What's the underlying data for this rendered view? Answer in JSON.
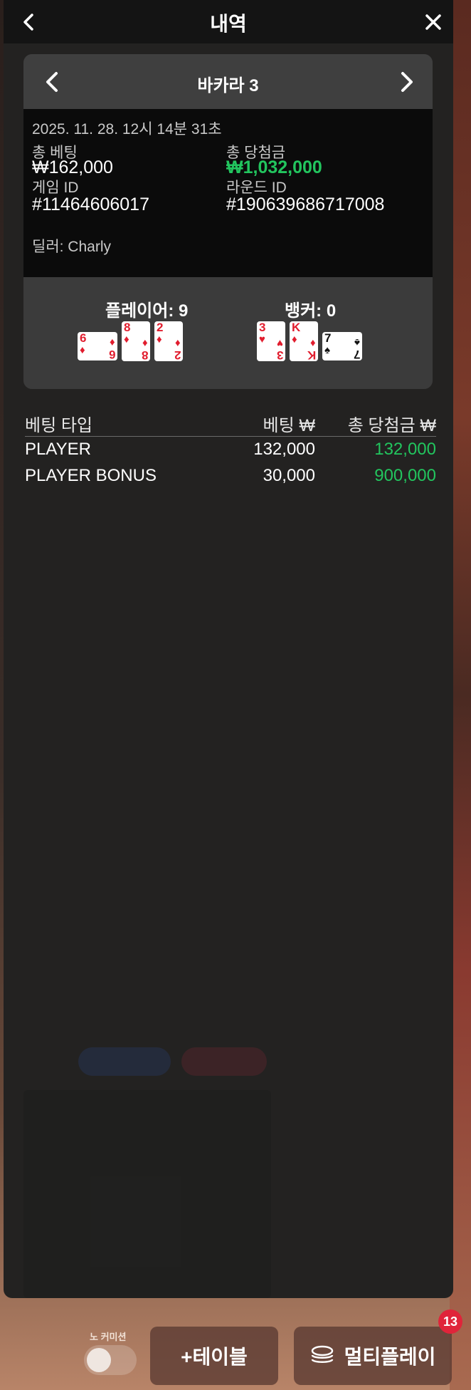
{
  "header": {
    "title": "내역"
  },
  "table_card": {
    "name": "바카라 3",
    "datetime": "2025. 11. 28. 12시 14분 31초",
    "total_bet_label": "총 베팅",
    "total_bet_value": "₩162,000",
    "total_win_label": "총 당첨금",
    "total_win_value": "₩1,032,000",
    "game_id_label": "게임 ID",
    "game_id_value": "#11464606017",
    "round_id_label": "라운드 ID",
    "round_id_value": "#190639686717008",
    "dealer": "딜러: Charly",
    "player_label": "플레이어: 9",
    "banker_label": "뱅커: 0",
    "player_cards": [
      {
        "rank": "6",
        "suit": "♦",
        "color": "#e11d2e",
        "rotated": true
      },
      {
        "rank": "8",
        "suit": "♦",
        "color": "#e11d2e",
        "rotated": false
      },
      {
        "rank": "2",
        "suit": "♦",
        "color": "#e11d2e",
        "rotated": false
      }
    ],
    "banker_cards": [
      {
        "rank": "3",
        "suit": "♥",
        "color": "#e11d2e",
        "rotated": false
      },
      {
        "rank": "K",
        "suit": "♦",
        "color": "#e11d2e",
        "rotated": false
      },
      {
        "rank": "7",
        "suit": "♠",
        "color": "#111111",
        "rotated": true
      }
    ]
  },
  "bets_table": {
    "headers": [
      "베팅 타입",
      "베팅 ₩",
      "총 당첨금 ₩"
    ],
    "rows": [
      {
        "type": "PLAYER",
        "bet": "132,000",
        "win": "132,000"
      },
      {
        "type": "PLAYER BONUS",
        "bet": "30,000",
        "win": "900,000"
      }
    ]
  },
  "bottom_bar": {
    "no_commission_label": "노 커미션",
    "add_table_label": "+테이블",
    "multiplay_label": "멀티플레이",
    "multiplay_badge": "13"
  },
  "colors": {
    "win_green": "#22c55e",
    "badge_red": "#e0243a"
  }
}
